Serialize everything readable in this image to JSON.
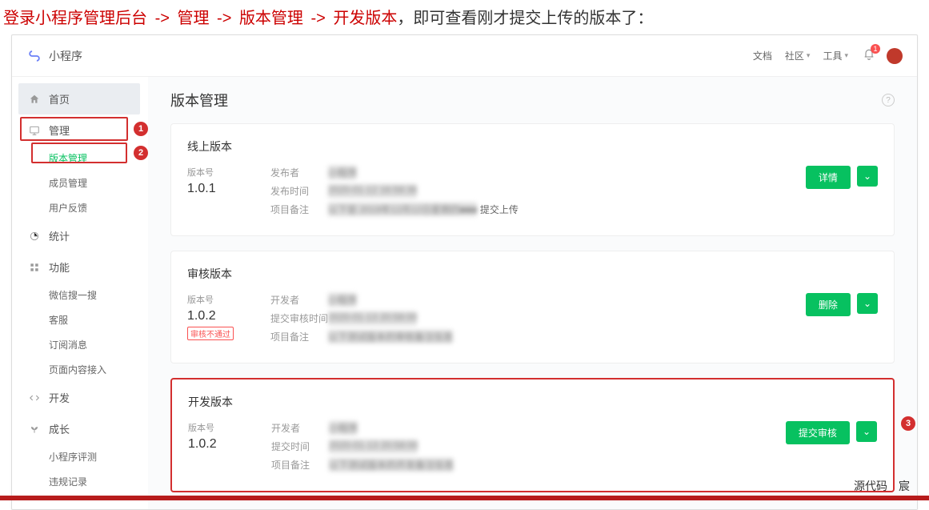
{
  "instruction": {
    "parts": [
      "登录小程序管理后台",
      "管理",
      "版本管理",
      "开发版本"
    ],
    "suffix": "，即可查看刚才提交上传的版本了："
  },
  "topbar": {
    "app_name": "小程序",
    "links": {
      "docs": "文档",
      "community": "社区",
      "tools": "工具"
    },
    "notif_count": "1"
  },
  "sidebar": {
    "home": "首页",
    "manage": "管理",
    "manage_sub": {
      "version": "版本管理",
      "members": "成员管理",
      "feedback": "用户反馈"
    },
    "stats": "统计",
    "features": "功能",
    "features_sub": {
      "search": "微信搜一搜",
      "csr": "客服",
      "submsg": "订阅消息",
      "pageconn": "页面内容接入"
    },
    "develop": "开发",
    "growth": "成长",
    "growth_sub": {
      "eval": "小程序评测",
      "violation": "违规记录"
    }
  },
  "callouts": {
    "c1": "1",
    "c2": "2",
    "c3": "3"
  },
  "main": {
    "title": "版本管理",
    "keys": {
      "version": "版本号",
      "publisher": "发布者",
      "developer": "开发者",
      "pubtime": "发布时间",
      "reviewtime": "提交审核时间",
      "submittime": "提交时间",
      "remark": "项目备注"
    },
    "online": {
      "title": "线上版本",
      "version": "1.0.1",
      "publisher": "小程序",
      "pubtime": "2020-01-12 16:58:36",
      "remark_prefix": "以下是 2019年12月12日星期四■■■ ",
      "remark_suffix": "提交上传",
      "btn": "详情"
    },
    "review": {
      "title": "审核版本",
      "version": "1.0.2",
      "status": "审核不通过",
      "developer": "小程序",
      "reviewtime": "2020-01-13 20:58:00",
      "remark": "以下测试版本的审核备注信息",
      "btn": "删除"
    },
    "dev": {
      "title": "开发版本",
      "version": "1.0.2",
      "developer": "小程序",
      "submittime": "2020-01-13 20:58:00",
      "remark": "以下测试版本的开发备注信息",
      "btn": "提交审核"
    }
  },
  "footer": {
    "credit": "源代码　宸"
  }
}
